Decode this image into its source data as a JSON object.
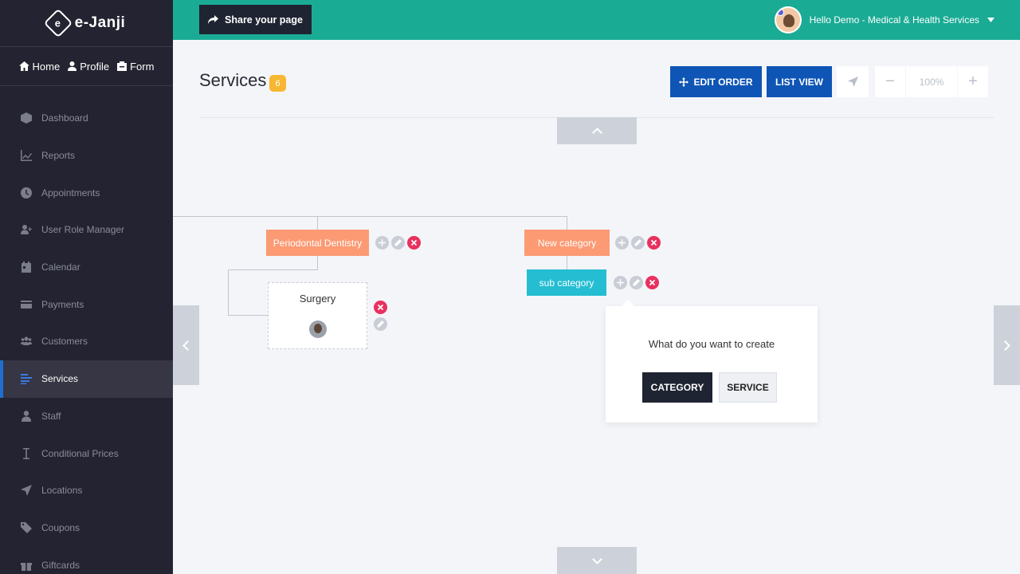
{
  "brand": {
    "name": "e-Janji"
  },
  "quicknav": {
    "home": "Home",
    "profile": "Profile",
    "form": "Form"
  },
  "sidebar": {
    "items": [
      {
        "label": "Dashboard",
        "icon": "cube-icon"
      },
      {
        "label": "Reports",
        "icon": "chart-icon"
      },
      {
        "label": "Appointments",
        "icon": "clock-icon"
      },
      {
        "label": "User Role Manager",
        "icon": "user-plus-icon"
      },
      {
        "label": "Calendar",
        "icon": "calendar-icon"
      },
      {
        "label": "Payments",
        "icon": "card-icon"
      },
      {
        "label": "Customers",
        "icon": "users-icon"
      },
      {
        "label": "Services",
        "icon": "list-icon",
        "active": true
      },
      {
        "label": "Staff",
        "icon": "user-icon"
      },
      {
        "label": "Conditional Prices",
        "icon": "cursor-icon"
      },
      {
        "label": "Locations",
        "icon": "location-arrow-icon"
      },
      {
        "label": "Coupons",
        "icon": "tag-icon"
      },
      {
        "label": "Giftcards",
        "icon": "gift-icon"
      }
    ]
  },
  "header": {
    "share_label": "Share your page",
    "greeting": "Hello Demo - Medical & Health Services"
  },
  "page": {
    "title": "Services",
    "count": "6",
    "edit_order": "EDIT ORDER",
    "list_view": "LIST VIEW",
    "zoom": "100%"
  },
  "tree": {
    "cat1": "Periodontal Dentistry",
    "cat2": "New category",
    "sub": "sub category",
    "service": "Surgery"
  },
  "popup": {
    "question": "What do you want to create",
    "category": "CATEGORY",
    "service": "SERVICE"
  },
  "colors": {
    "accent": "#1aab95",
    "primary": "#0e55b5",
    "category": "#fc9a74",
    "subcategory": "#24bdd2",
    "danger": "#e8315f"
  }
}
